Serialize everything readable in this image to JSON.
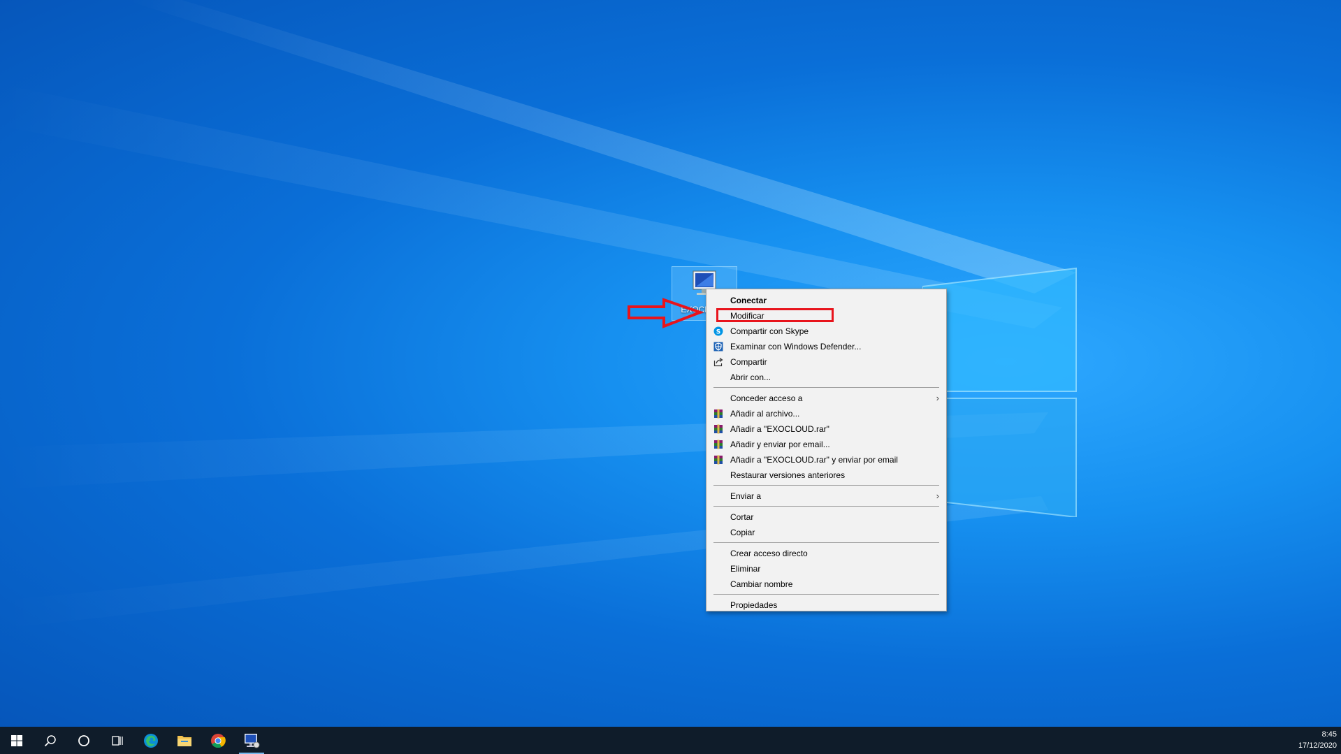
{
  "desktop": {
    "icon": {
      "label": "EXOCLOUD",
      "icon": "remote-desktop-icon"
    }
  },
  "context_menu": {
    "groups": [
      [
        {
          "label": "Conectar",
          "bold": true,
          "icon": ""
        },
        {
          "label": "Modificar",
          "icon": ""
        },
        {
          "label": "Compartir con Skype",
          "icon": "skype-icon"
        },
        {
          "label": "Examinar con Windows Defender...",
          "icon": "defender-icon"
        },
        {
          "label": "Compartir",
          "icon": "share-icon"
        },
        {
          "label": "Abrir con...",
          "icon": ""
        }
      ],
      [
        {
          "label": "Conceder acceso a",
          "icon": "",
          "submenu": true
        },
        {
          "label": "Añadir al archivo...",
          "icon": "winrar-icon"
        },
        {
          "label": "Añadir a \"EXOCLOUD.rar\"",
          "icon": "winrar-icon"
        },
        {
          "label": "Añadir y enviar por email...",
          "icon": "winrar-icon"
        },
        {
          "label": "Añadir a \"EXOCLOUD.rar\" y enviar por email",
          "icon": "winrar-icon"
        },
        {
          "label": "Restaurar versiones anteriores",
          "icon": ""
        }
      ],
      [
        {
          "label": "Enviar a",
          "icon": "",
          "submenu": true
        }
      ],
      [
        {
          "label": "Cortar",
          "icon": ""
        },
        {
          "label": "Copiar",
          "icon": ""
        }
      ],
      [
        {
          "label": "Crear acceso directo",
          "icon": ""
        },
        {
          "label": "Eliminar",
          "icon": ""
        },
        {
          "label": "Cambiar nombre",
          "icon": ""
        }
      ],
      [
        {
          "label": "Propiedades",
          "icon": ""
        }
      ]
    ],
    "highlighted_item": "Modificar",
    "submenu_arrow": "›"
  },
  "taskbar": {
    "buttons": [
      {
        "name": "start-button",
        "icon": "windows-start-icon"
      },
      {
        "name": "search-button",
        "icon": "search-icon"
      },
      {
        "name": "cortana-button",
        "icon": "cortana-circle-icon"
      },
      {
        "name": "task-view-button",
        "icon": "task-view-icon"
      },
      {
        "name": "edge-button",
        "icon": "edge-icon"
      },
      {
        "name": "file-explorer-button",
        "icon": "folder-icon"
      },
      {
        "name": "chrome-button",
        "icon": "chrome-icon"
      },
      {
        "name": "remote-desktop-button",
        "icon": "remote-desktop-icon",
        "active": true
      }
    ],
    "clock": {
      "time": "8:45",
      "date": "17/12/2020"
    }
  },
  "colors": {
    "annotation_red": "#e8141c",
    "taskbar": "#0f1c2a",
    "menu_bg": "#f2f2f2"
  }
}
